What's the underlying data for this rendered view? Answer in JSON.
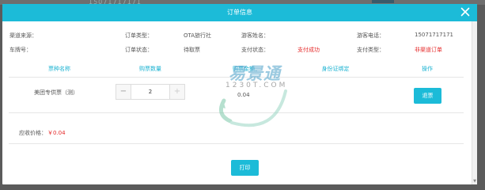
{
  "backdrop": {
    "phone_text": "15071717171"
  },
  "modal": {
    "title": "订单信息",
    "info": {
      "channel_label": "渠道来源：",
      "order_type_label": "订单类型：",
      "order_type_value": "OTA旅行社",
      "visitor_name_label": "游客姓名：",
      "visitor_name_value": "",
      "visitor_phone_label": "游客电话：",
      "visitor_phone_value": "15071717171",
      "plate_label": "车牌号：",
      "order_status_label": "订单状态：",
      "order_status_value": "待取票",
      "pay_status_label": "支付状态：",
      "pay_status_value": "支付成功",
      "pay_type_label": "支付类型：",
      "pay_type_value": "非渠道订单"
    },
    "table": {
      "headers": [
        "票种名称",
        "购票数量",
        "购票金额",
        "身份证绑定",
        "操作"
      ],
      "row": {
        "ticket_name": "美团专供票（测）",
        "quantity": "2",
        "amount": "0.04",
        "refund_label": "退票"
      }
    },
    "receivable_label": "应收价格：",
    "receivable_value": "￥0.04",
    "print_label": "打印"
  },
  "watermark": {
    "brand": "易景通",
    "domain": "1230T.COM"
  },
  "colors": {
    "accent": "#1cbbd8",
    "alert": "#e52a2a"
  }
}
